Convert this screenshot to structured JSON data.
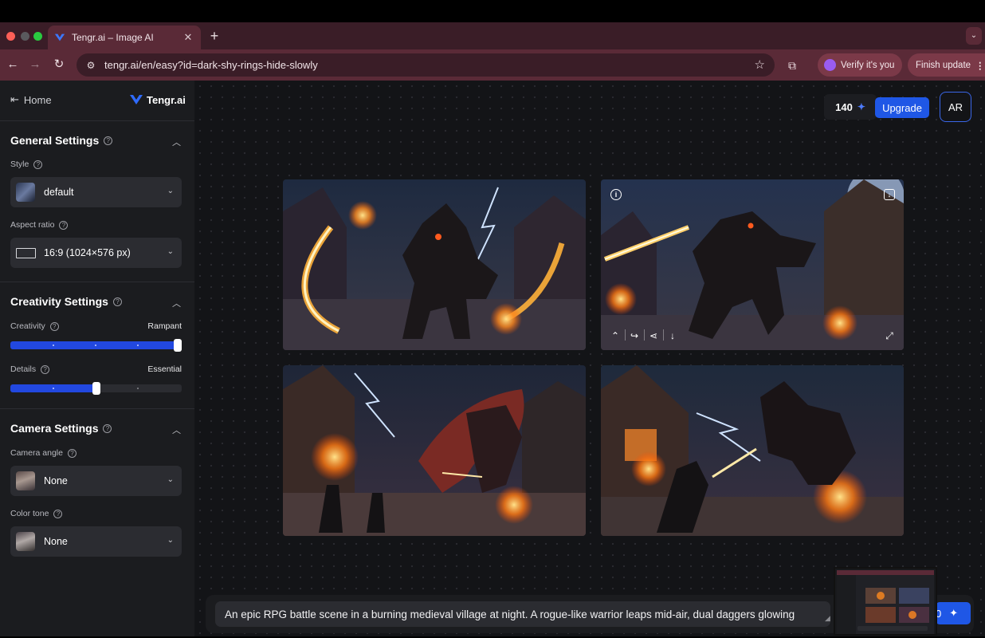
{
  "browser": {
    "tab_title": "Tengr.ai – Image AI",
    "url": "tengr.ai/en/easy?id=dark-shy-rings-hide-slowly",
    "verify_label": "Verify it's you",
    "finish_update_label": "Finish update"
  },
  "sidebar": {
    "home_label": "Home",
    "logo_text": "Tengr.ai",
    "general": {
      "title": "General Settings",
      "style_label": "Style",
      "style_value": "default",
      "aspect_label": "Aspect ratio",
      "aspect_value": "16:9 (1024×576 px)"
    },
    "creativity": {
      "title": "Creativity Settings",
      "creativity_label": "Creativity",
      "creativity_value": "Rampant",
      "creativity_level": 1.0,
      "details_label": "Details",
      "details_value": "Essential",
      "details_level": 0.5
    },
    "camera": {
      "title": "Camera Settings",
      "angle_label": "Camera angle",
      "angle_value": "None",
      "tone_label": "Color tone",
      "tone_value": "None"
    }
  },
  "header": {
    "credits": "140",
    "upgrade_label": "Upgrade",
    "avatar_initials": "AR"
  },
  "prompt": {
    "text": "An epic RPG battle scene in a burning medieval village at night. A rogue-like warrior leaps mid-air, dual daggers glowing",
    "generate_label": "0"
  },
  "colors": {
    "accent": "#1f57e6",
    "tab_bar": "#3a1d27",
    "toolbar": "#5a2a37",
    "sidebar_bg": "#1b1c1f",
    "main_bg": "#131417"
  }
}
